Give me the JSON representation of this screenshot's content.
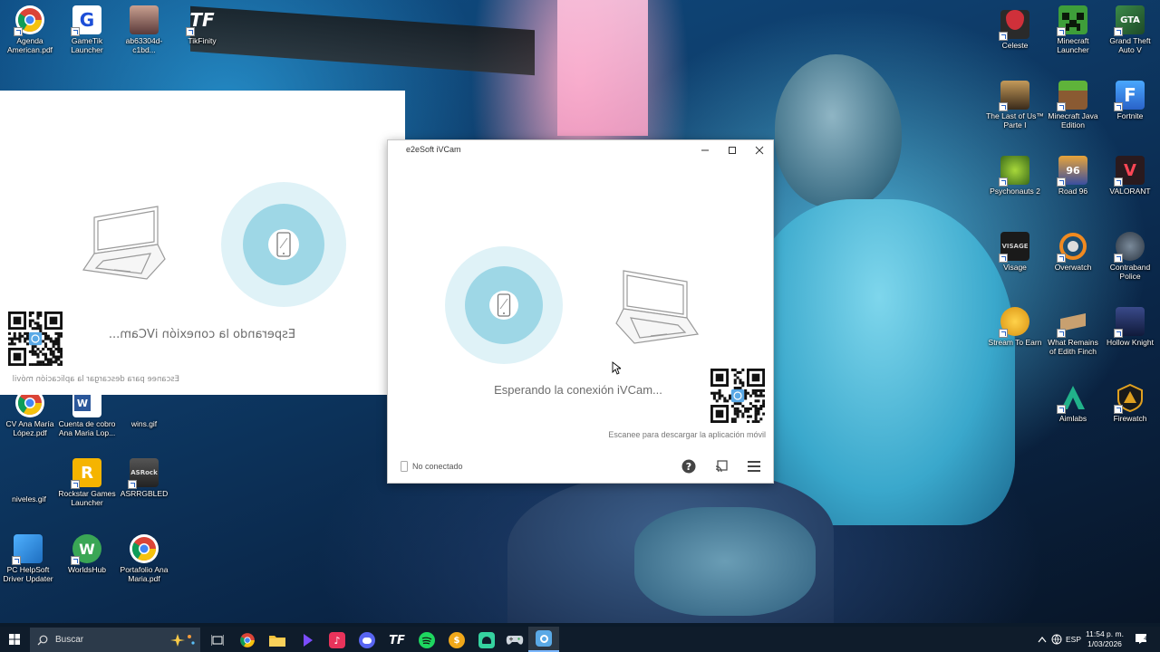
{
  "desktop": {
    "left_icons": [
      {
        "label": "Agenda American.pdf",
        "icon": "chrome-pdf-icon",
        "color": "#ffffff"
      },
      {
        "label": "GameTik Launcher",
        "icon": "gametik-icon",
        "color": "#ffffff"
      },
      {
        "label": "ab63304d-c1bd...",
        "icon": "photo-thumbnail-icon",
        "color": "#5a3a3a"
      },
      {
        "label": "TikFinity",
        "icon": "tikfinity-icon",
        "color": "#111111"
      },
      {
        "label": "CV Ana María López.pdf",
        "icon": "chrome-pdf-icon",
        "color": "#ffffff"
      },
      {
        "label": "Cuenta de cobro Ana Maria Lop...",
        "icon": "word-document-icon",
        "color": "#ffffff"
      },
      {
        "label": "wins.gif",
        "icon": "gif-file-icon",
        "color": "#ffffff"
      },
      {
        "label": "niveles.gif",
        "icon": "gif-file-icon",
        "color": "#ffffff"
      },
      {
        "label": "Rockstar Games Launcher",
        "icon": "rockstar-icon",
        "color": "#f5b400"
      },
      {
        "label": "ASRRGBLED",
        "icon": "asrock-icon",
        "color": "#333333"
      },
      {
        "label": "PC HelpSoft Driver Updater",
        "icon": "driver-updater-icon",
        "color": "#2a8ad4"
      },
      {
        "label": "WorldsHub",
        "icon": "worldshub-icon",
        "color": "#3aa655"
      },
      {
        "label": "Portafolio Ana Maria.pdf",
        "icon": "chrome-pdf-icon",
        "color": "#ffffff"
      }
    ],
    "right_icons": [
      {
        "label": "Celeste",
        "icon": "celeste-strawberry-icon",
        "color": "#c0303a"
      },
      {
        "label": "Minecraft Launcher",
        "icon": "minecraft-creeper-icon",
        "color": "#3e9e3a"
      },
      {
        "label": "Grand Theft Auto V",
        "icon": "gta-v-icon",
        "color": "#2f6e3a"
      },
      {
        "label": "The Last of Us™ Parte I",
        "icon": "last-of-us-icon",
        "color": "#8a6a3a"
      },
      {
        "label": "Minecraft Java Edition",
        "icon": "minecraft-grass-icon",
        "color": "#5a9e3a"
      },
      {
        "label": "Fortnite",
        "icon": "fortnite-icon",
        "color": "#3a8ae0"
      },
      {
        "label": "Psychonauts 2",
        "icon": "psychonauts-icon",
        "color": "#6a9a2a"
      },
      {
        "label": "Road 96",
        "icon": "road-96-icon",
        "color": "#3a4ea0"
      },
      {
        "label": "VALORANT",
        "icon": "valorant-icon",
        "color": "#e8404a"
      },
      {
        "label": "Visage",
        "icon": "visage-icon",
        "color": "#555555"
      },
      {
        "label": "Overwatch",
        "icon": "overwatch-icon",
        "color": "#f08a20"
      },
      {
        "label": "Contraband Police",
        "icon": "contraband-police-icon",
        "color": "#445566"
      },
      {
        "label": "Stream To Earn",
        "icon": "stream-to-earn-icon",
        "color": "#f0b020"
      },
      {
        "label": "What Remains of Edith Finch",
        "icon": "edith-finch-icon",
        "color": "#c8a070"
      },
      {
        "label": "Hollow Knight",
        "icon": "hollow-knight-icon",
        "color": "#2a3a6a"
      },
      {
        "label": "Aimlabs",
        "icon": "aimlabs-icon",
        "color": "#21b28a"
      },
      {
        "label": "Firewatch",
        "icon": "firewatch-icon",
        "color": "#e0a020"
      }
    ]
  },
  "ghost_window": {
    "waiting_text": "Esperando la conexión iVCam...",
    "scan_text": "Escanee para descargar la aplicación móvil"
  },
  "ivcam": {
    "title": "e2eSoft iVCam",
    "waiting_text": "Esperando la conexión iVCam...",
    "scan_text": "Escanee para descargar la aplicación móvil",
    "status": "No conectado",
    "accent": "#67c5db"
  },
  "taskbar": {
    "search_placeholder": "Buscar",
    "language": "ESP",
    "time": "11:54 p. m.",
    "date": "1/03/2026",
    "apps": [
      "task-view-icon",
      "chrome-icon",
      "file-explorer-icon",
      "gametik-taskbar-icon",
      "tiktok-icon",
      "discord-icon",
      "tikfinity-taskbar-icon",
      "spotify-icon",
      "coin-app-icon",
      "android-app-icon",
      "xbox-controller-icon",
      "ivcam-taskbar-icon"
    ]
  }
}
